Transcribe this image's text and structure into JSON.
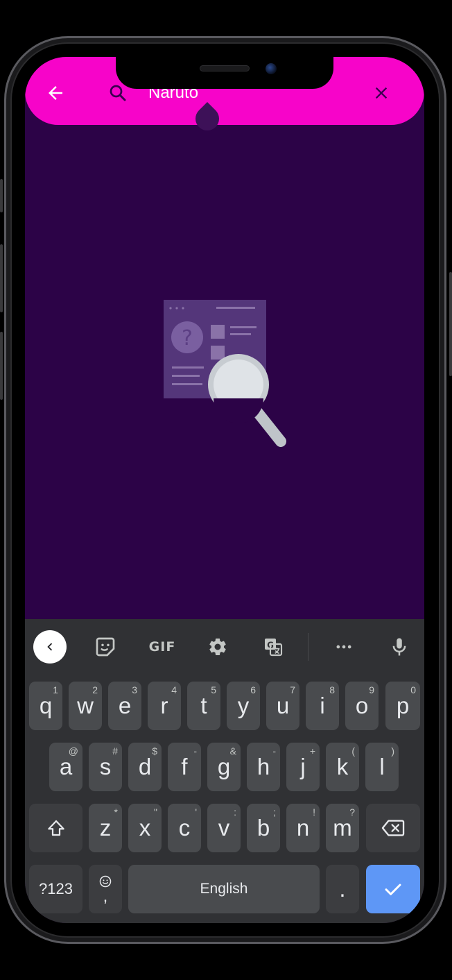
{
  "search": {
    "query": "Naruto",
    "back_label": "back-arrow-icon",
    "search_icon": "search-icon",
    "clear_icon": "close-icon"
  },
  "colors": {
    "app_bar": "#f704c9",
    "background": "#2c0347",
    "keyboard": "#303134",
    "key": "#494b4e",
    "enter_key": "#5e97f6"
  },
  "empty_state": {
    "icon": "document-search-icon"
  },
  "keyboard": {
    "toolbar": {
      "gif_label": "GIF",
      "icons": [
        "chevron-left-icon",
        "sticker-icon",
        "gif-icon",
        "gear-icon",
        "translate-icon",
        "more-icon",
        "mic-icon"
      ]
    },
    "row1": [
      {
        "label": "q",
        "hint": "1"
      },
      {
        "label": "w",
        "hint": "2"
      },
      {
        "label": "e",
        "hint": "3"
      },
      {
        "label": "r",
        "hint": "4"
      },
      {
        "label": "t",
        "hint": "5"
      },
      {
        "label": "y",
        "hint": "6"
      },
      {
        "label": "u",
        "hint": "7"
      },
      {
        "label": "i",
        "hint": "8"
      },
      {
        "label": "o",
        "hint": "9"
      },
      {
        "label": "p",
        "hint": "0"
      }
    ],
    "row2": [
      {
        "label": "a",
        "hint": "@"
      },
      {
        "label": "s",
        "hint": "#"
      },
      {
        "label": "d",
        "hint": "$"
      },
      {
        "label": "f",
        "hint": "-"
      },
      {
        "label": "g",
        "hint": "&"
      },
      {
        "label": "h",
        "hint": "-"
      },
      {
        "label": "j",
        "hint": "+"
      },
      {
        "label": "k",
        "hint": "("
      },
      {
        "label": "l",
        "hint": ")"
      }
    ],
    "row3": [
      {
        "label": "z",
        "hint": "*"
      },
      {
        "label": "x",
        "hint": "\""
      },
      {
        "label": "c",
        "hint": "'"
      },
      {
        "label": "v",
        "hint": ":"
      },
      {
        "label": "b",
        "hint": ";"
      },
      {
        "label": "n",
        "hint": "!"
      },
      {
        "label": "m",
        "hint": "?"
      }
    ],
    "symbols_label": "?123",
    "emoji_comma": ",",
    "space_label": "English",
    "period_label": "."
  }
}
